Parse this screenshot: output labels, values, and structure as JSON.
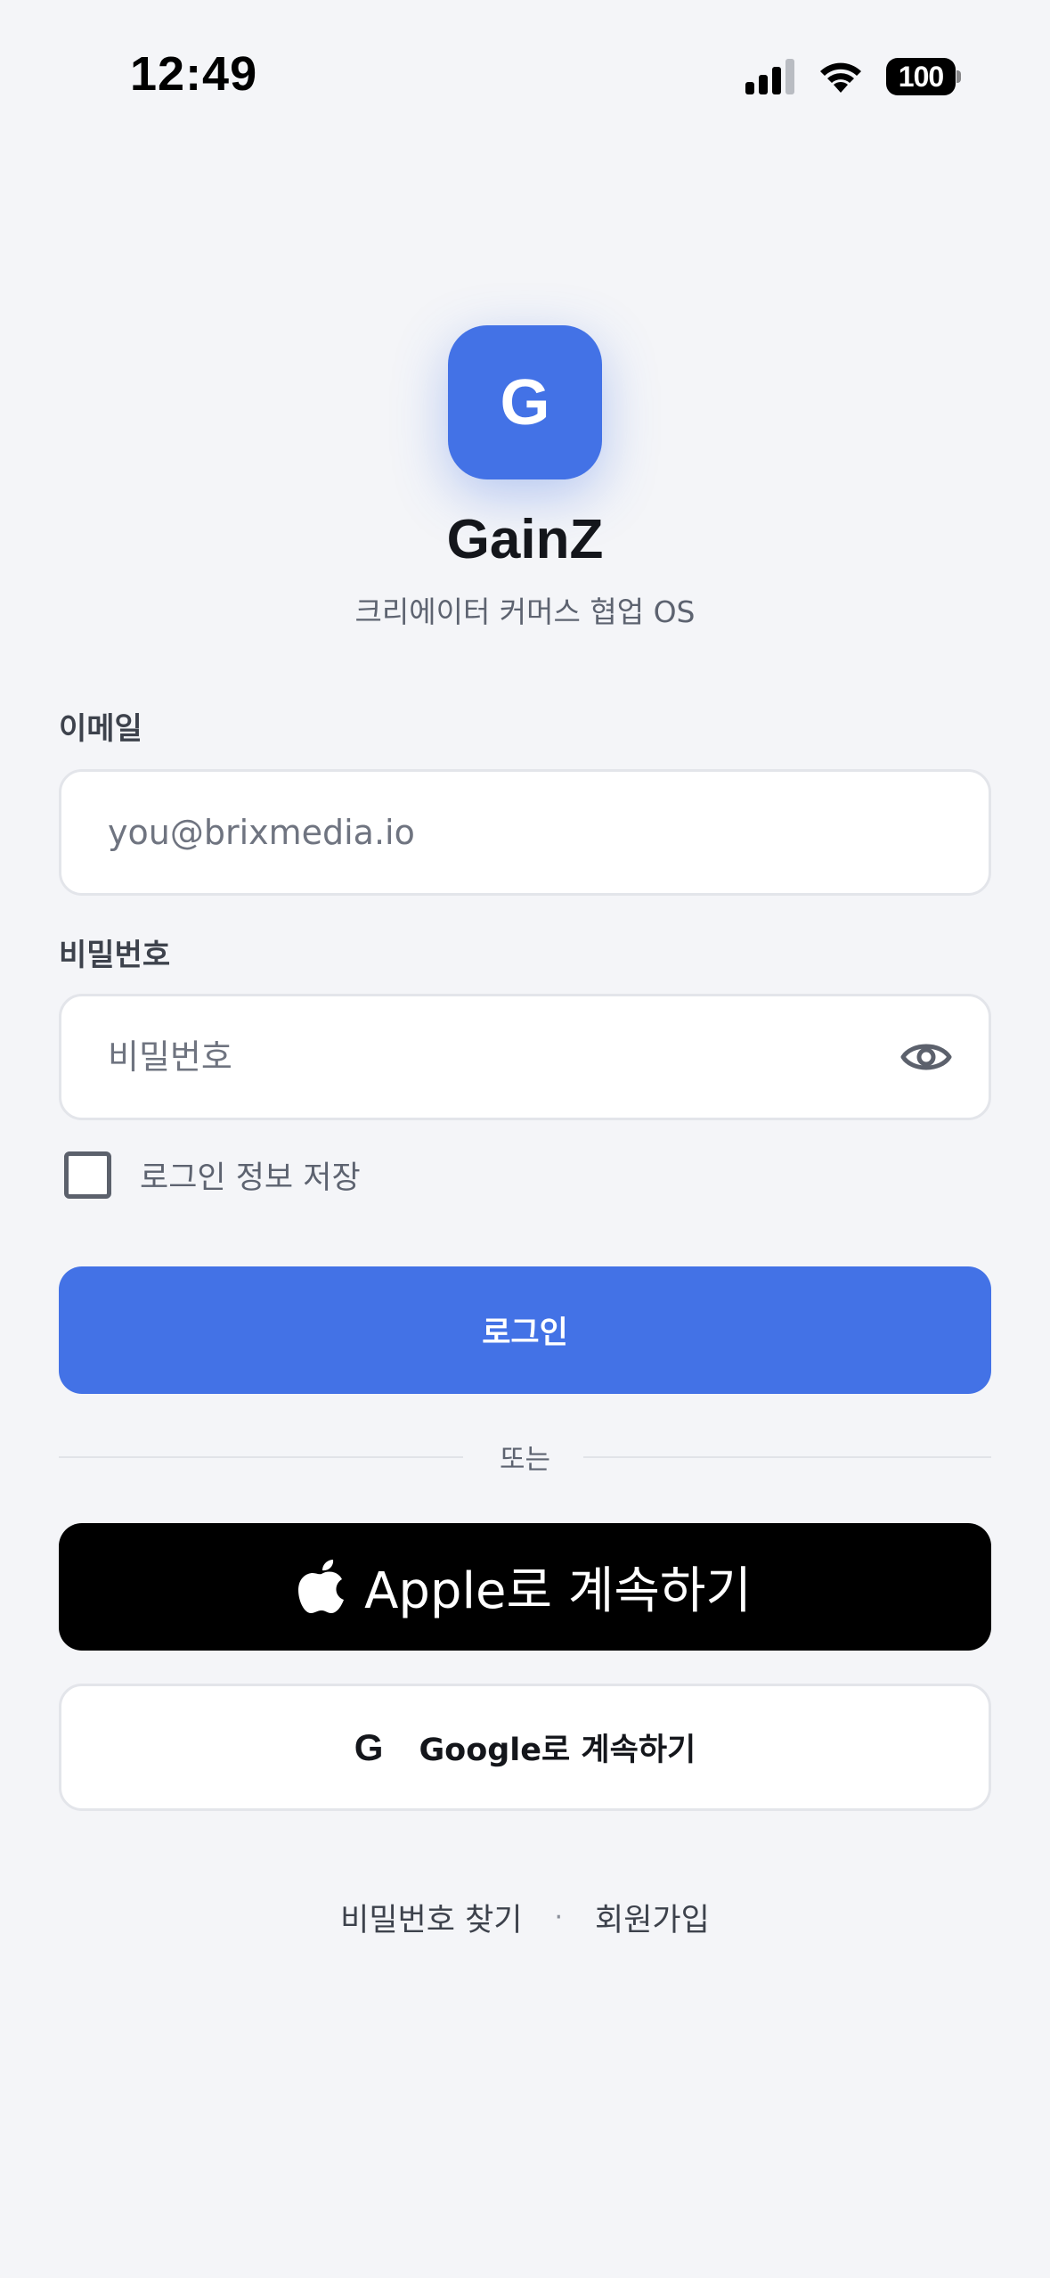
{
  "status_bar": {
    "time": "12:49",
    "battery": "100",
    "icons": [
      "signal-icon",
      "wifi-icon",
      "battery-icon"
    ]
  },
  "brand": {
    "logo_letter": "G",
    "name": "GainZ",
    "tagline": "크리에이터 커머스 협업 OS",
    "accent_color": "#4372e6"
  },
  "form": {
    "email_label": "이메일",
    "email_placeholder": "you@brixmedia.io",
    "password_label": "비밀번호",
    "password_placeholder": "비밀번호",
    "remember_label": "로그인 정보 저장",
    "remember_checked": false,
    "login_button": "로그인"
  },
  "divider_text": "또는",
  "social": {
    "apple_label": "Apple로 계속하기",
    "google_icon_letter": "G",
    "google_label": "Google로 계속하기"
  },
  "footer": {
    "find_password": "비밀번호 찾기",
    "separator": "·",
    "sign_up": "회원가입"
  }
}
